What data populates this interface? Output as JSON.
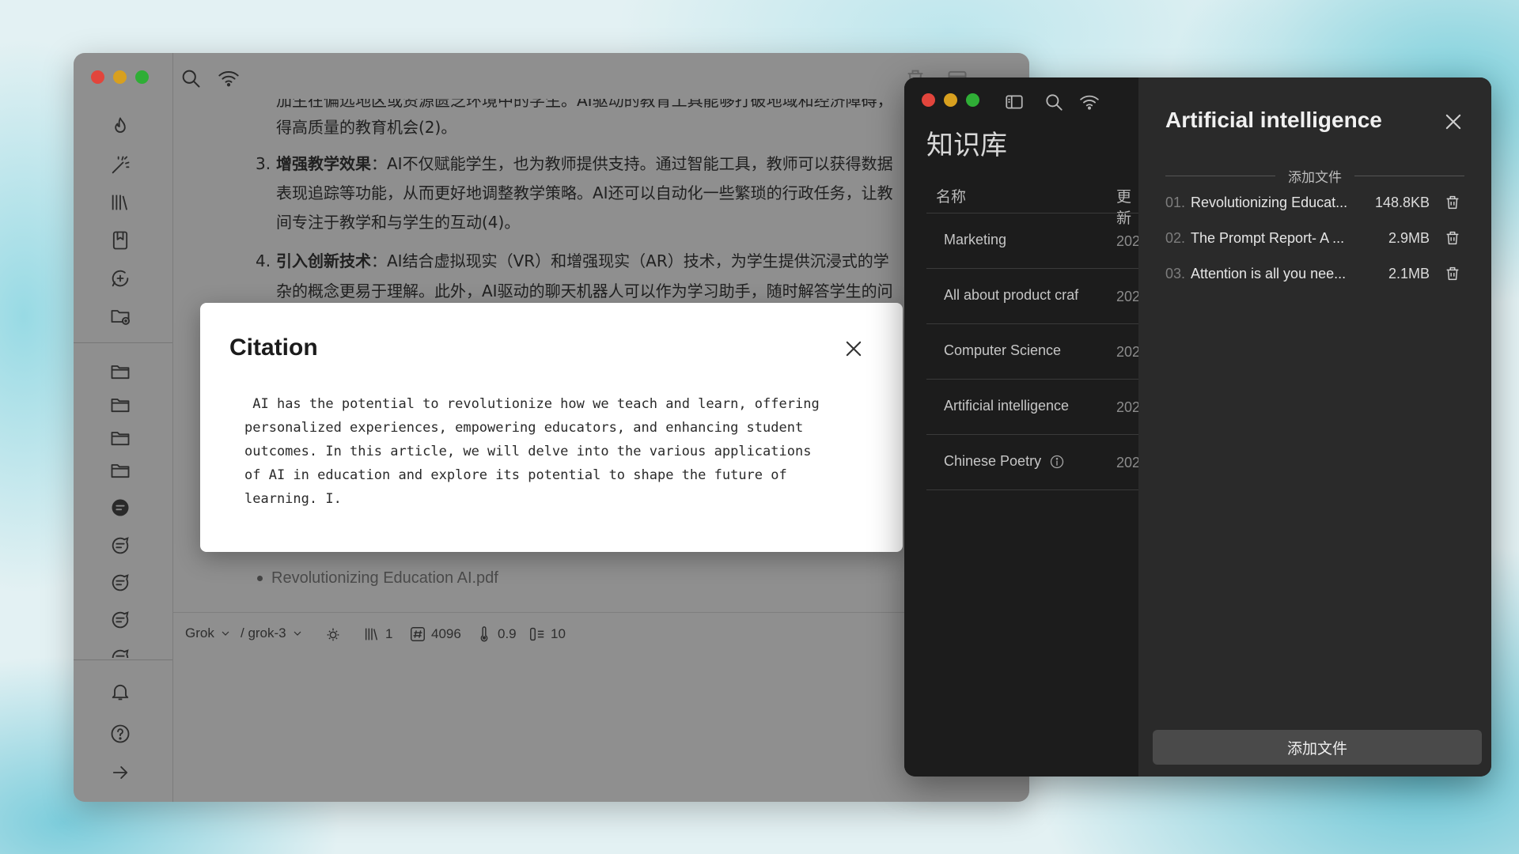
{
  "main_window": {
    "paragraphs": [
      {
        "text": "加生在偏远地区或资源匮乏环境中的学生。AI驱动的教育工具能够打破地域和经济障碍，"
      },
      {
        "text": "得高质量的教育机会(2)。"
      },
      {
        "number": "3.",
        "bold": "增强教学效果",
        "text": "：AI不仅赋能学生，也为教师提供支持。通过智能工具，教师可以获得数据"
      },
      {
        "text": "表现追踪等功能，从而更好地调整教学策略。AI还可以自动化一些繁琐的行政任务，让教"
      },
      {
        "text": "间专注于教学和与学生的互动(4)。"
      },
      {
        "number": "4.",
        "bold": "引入创新技术",
        "text": "：AI结合虚拟现实（VR）和增强现实（AR）技术，为学生提供沉浸式的学"
      },
      {
        "text": "杂的概念更易于理解。此外，AI驱动的聊天机器人可以作为学习助手，随时解答学生的问"
      }
    ],
    "source_file": "Revolutionizing Education AI.pdf",
    "toolbar": {
      "provider": "Grok",
      "model": "/ grok-3",
      "kb_count": "1",
      "max_tokens": "4096",
      "temperature": "0.9",
      "context_count": "10"
    }
  },
  "citation_modal": {
    "title": "Citation",
    "body": " AI has the potential to revolutionize how we teach and learn, offering\npersonalized experiences, empowering educators, and enhancing student\noutcomes. In this article, we will delve into the various applications\nof AI in education and explore its potential to shape the future of\nlearning. I."
  },
  "knowledge_window": {
    "title": "知识库",
    "col_name": "名称",
    "col_updated": "更新",
    "items": [
      {
        "name": "Marketing",
        "date": "202",
        "info": false
      },
      {
        "name": "All about product craf",
        "date": "202",
        "info": false
      },
      {
        "name": "Computer Science",
        "date": "202",
        "info": false
      },
      {
        "name": "Artificial intelligence",
        "date": "202",
        "info": false
      },
      {
        "name": "Chinese Poetry",
        "date": "202",
        "info": true
      }
    ],
    "detail": {
      "title": "Artificial intelligence",
      "section_label": "添加文件",
      "files": [
        {
          "index": "01.",
          "name": "Revolutionizing Educat...",
          "size": "148.8KB"
        },
        {
          "index": "02.",
          "name": "The Prompt Report- A ...",
          "size": "2.9MB"
        },
        {
          "index": "03.",
          "name": "Attention is all you nee...",
          "size": "2.1MB"
        }
      ],
      "add_button": "添加文件"
    }
  },
  "colors": {
    "accent_red": "#e2453c",
    "accent_yellow": "#d8a01f",
    "accent_green": "#2fae36",
    "dark_panel": "#2a2a2a",
    "modal_bg": "#ffffff"
  }
}
